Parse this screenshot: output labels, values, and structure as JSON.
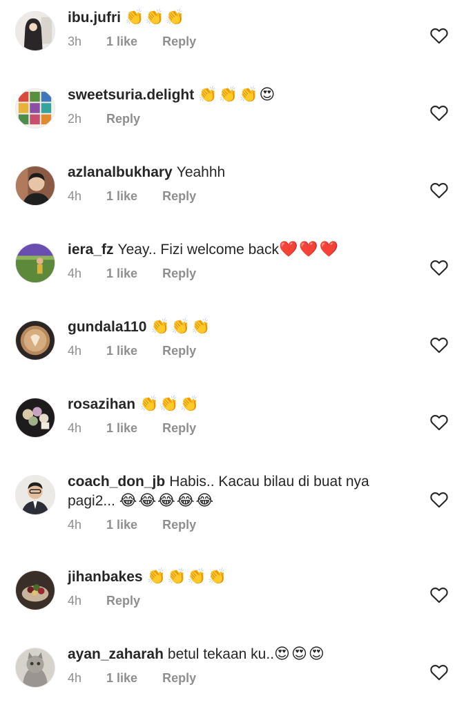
{
  "comments": [
    {
      "username": "ibu.jufri",
      "text": "",
      "emoji": "👏👏👏",
      "time": "3h",
      "likes": "1 like",
      "reply": "Reply",
      "avatar": "avatar-woman-hijab"
    },
    {
      "username": "sweetsuria.delight",
      "text": "",
      "emoji": "👏👏👏😍",
      "time": "2h",
      "likes": "",
      "reply": "Reply",
      "avatar": "avatar-food-grid"
    },
    {
      "username": "azlanalbukhary",
      "text": "Yeahhh",
      "emoji": "",
      "time": "4h",
      "likes": "1 like",
      "reply": "Reply",
      "avatar": "avatar-man-portrait"
    },
    {
      "username": "iera_fz",
      "text": "Yeay.. Fizi welcome back",
      "emoji": "❤️❤️❤️",
      "time": "4h",
      "likes": "1 like",
      "reply": "Reply",
      "avatar": "avatar-field-purple"
    },
    {
      "username": "gundala110",
      "text": "",
      "emoji": "👏👏👏",
      "time": "4h",
      "likes": "1 like",
      "reply": "Reply",
      "avatar": "avatar-latte-art"
    },
    {
      "username": "rosazihan",
      "text": "",
      "emoji": "👏👏👏",
      "time": "4h",
      "likes": "1 like",
      "reply": "Reply",
      "avatar": "avatar-flowers-dark"
    },
    {
      "username": "coach_don_jb",
      "text": "Habis.. Kacau bilau di buat nya pagi2...",
      "emoji": "😂😂😂😂😂",
      "time": "4h",
      "likes": "1 like",
      "reply": "Reply",
      "avatar": "avatar-man-suit"
    },
    {
      "username": "jihanbakes",
      "text": "",
      "emoji": "👏👏👏👏",
      "time": "4h",
      "likes": "",
      "reply": "Reply",
      "avatar": "avatar-cake"
    },
    {
      "username": "ayan_zaharah",
      "text": "betul tekaan ku..",
      "emoji": "😍😍😍",
      "time": "4h",
      "likes": "1 like",
      "reply": "Reply",
      "avatar": "avatar-cat"
    }
  ],
  "icons": {
    "like": "heart-outline-icon"
  },
  "colors": {
    "text": "#262626",
    "secondary": "#8e8e8e",
    "background": "#ffffff"
  }
}
